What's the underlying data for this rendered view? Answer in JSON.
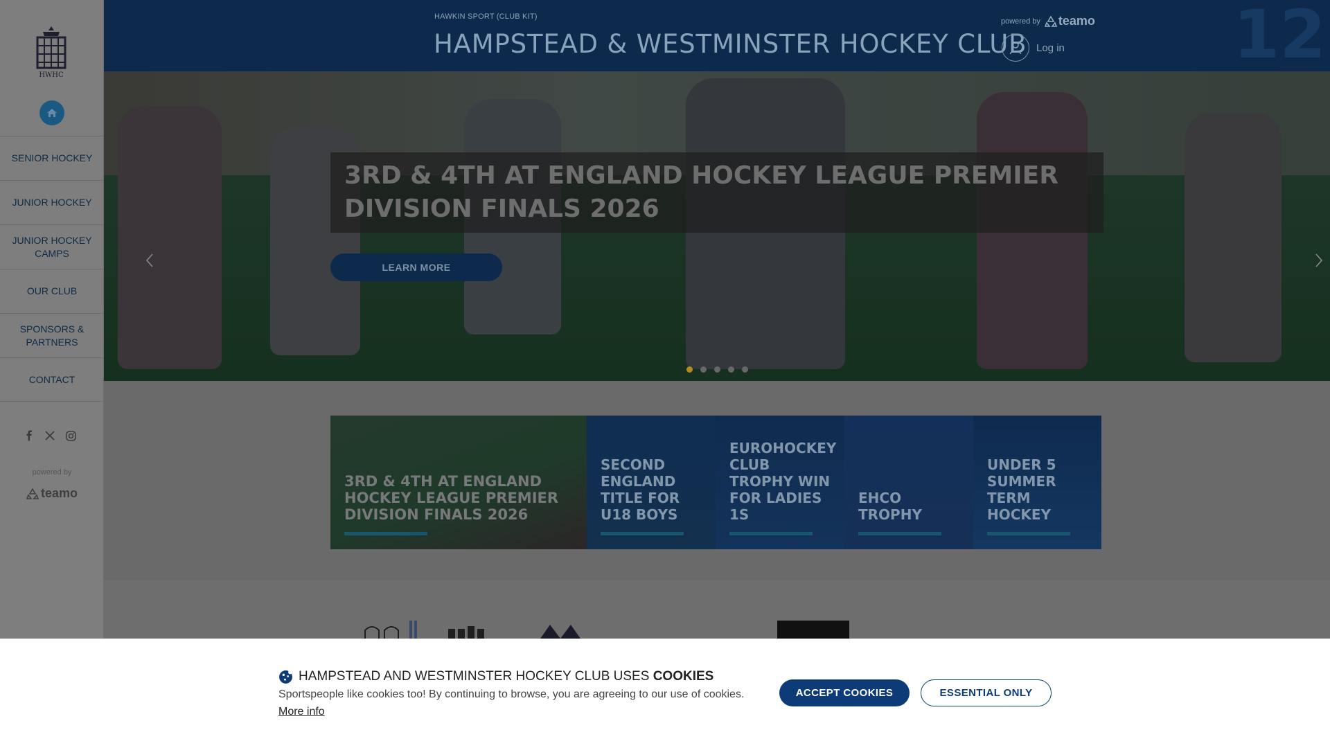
{
  "header": {
    "kicker": "HAWKIN SPORT (CLUB KIT)",
    "club_name": "HAMPSTEAD & WESTMINSTER HOCKEY CLUB",
    "powered_by": "powered by",
    "powered_logo": "teamo",
    "login_label": "Log in"
  },
  "sidebar": {
    "crest_text": "HWHC",
    "nav": [
      {
        "label": "SENIOR HOCKEY"
      },
      {
        "label": "JUNIOR HOCKEY"
      },
      {
        "label": "JUNIOR HOCKEY CAMPS"
      },
      {
        "label": "OUR CLUB"
      },
      {
        "label": "SPONSORS & PARTNERS"
      },
      {
        "label": "CONTACT"
      }
    ],
    "social_icons": [
      "facebook-icon",
      "x-icon",
      "instagram-icon"
    ],
    "powered_by": "powered by",
    "powered_logo": "teamo"
  },
  "hero": {
    "title": "3RD & 4TH AT ENGLAND HOCKEY LEAGUE PREMIER DIVISION FINALS 2026",
    "cta_label": "LEARN MORE",
    "slide_count": 5,
    "active_slide": 1,
    "active_dot_color": "#b38b1a"
  },
  "news": [
    {
      "title": "3RD & 4TH AT ENGLAND HOCKEY LEAGUE PREMIER DIVISION FINALS 2026"
    },
    {
      "title": "SECOND ENGLAND TITLE FOR U18 BOYS"
    },
    {
      "title": "EUROHOCKEY CLUB TROPHY WIN FOR LADIES 1S"
    },
    {
      "title": "EHCO TROPHY"
    },
    {
      "title": "UNDER 5 SUMMER TERM HOCKEY"
    }
  ],
  "cookie": {
    "heading_prefix": "HAMPSTEAD AND WESTMINSTER HOCKEY CLUB USES ",
    "heading_bold": "COOKIES",
    "body": "Sportspeople like cookies too! By continuing to browse, you are agreeing to our use of cookies.",
    "more_info": "More info",
    "accept_label": "ACCEPT COOKIES",
    "essential_label": "ESSENTIAL ONLY"
  },
  "colors": {
    "brand_navy": "#0d2a4c",
    "accent_blue": "#0d3b78",
    "home_button": "#1a5a82"
  }
}
